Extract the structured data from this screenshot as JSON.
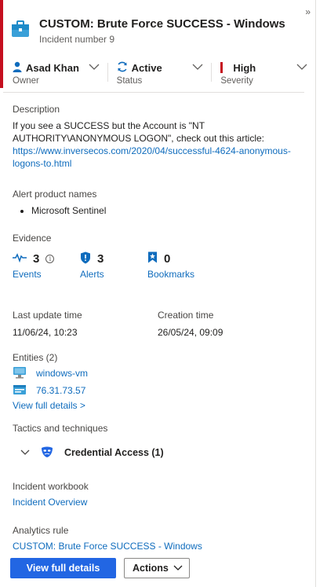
{
  "incident": {
    "title": "CUSTOM: Brute Force SUCCESS - Windows",
    "subtitle": "Incident number 9",
    "icon": "briefcase-icon",
    "accent_color": "#c50f1f"
  },
  "collapse_glyph": "»",
  "properties": {
    "owner": {
      "value": "Asad Khan",
      "label": "Owner",
      "icon": "person-icon"
    },
    "status": {
      "value": "Active",
      "label": "Status",
      "icon": "refresh-icon"
    },
    "severity": {
      "value": "High",
      "label": "Severity",
      "color": "#c50f1f"
    }
  },
  "description": {
    "label": "Description",
    "text": "If you see a SUCCESS but the Account is \"NT AUTHORITY\\ANONYMOUS LOGON\", check out this article:",
    "link_line1": "https://www.inversecos.com/2020/04/successful-4624-anonymous-",
    "link_line2": "logons-to.html"
  },
  "alert_product_names": {
    "label": "Alert product names",
    "items": [
      "Microsoft Sentinel"
    ]
  },
  "evidence": {
    "label": "Evidence",
    "events": {
      "count": "3",
      "label": "Events",
      "icon": "activity-icon"
    },
    "alerts": {
      "count": "3",
      "label": "Alerts",
      "icon": "shield-icon"
    },
    "bookmarks": {
      "count": "0",
      "label": "Bookmarks",
      "icon": "bookmark-icon"
    }
  },
  "times": {
    "last_update_label": "Last update time",
    "last_update_value": "11/06/24, 10:23",
    "creation_label": "Creation time",
    "creation_value": "26/05/24, 09:09"
  },
  "entities": {
    "label": "Entities (2)",
    "items": [
      {
        "name": "windows-vm",
        "icon": "monitor-icon"
      },
      {
        "name": "76.31.73.57",
        "icon": "ip-address-icon"
      }
    ],
    "view_full_details": "View full details >"
  },
  "tactics": {
    "label": "Tactics and techniques",
    "items": [
      {
        "name": "Credential Access (1)",
        "icon": "mask-icon"
      }
    ]
  },
  "workbook": {
    "label": "Incident workbook",
    "link": "Incident Overview"
  },
  "analytics_rule": {
    "label": "Analytics rule",
    "link": "CUSTOM: Brute Force SUCCESS - Windows"
  },
  "footer": {
    "primary_button": "View full details",
    "actions_button": "Actions"
  },
  "colors": {
    "link": "#0f6cbd",
    "primary_button": "#2266e3",
    "severity_high": "#c50f1f"
  }
}
